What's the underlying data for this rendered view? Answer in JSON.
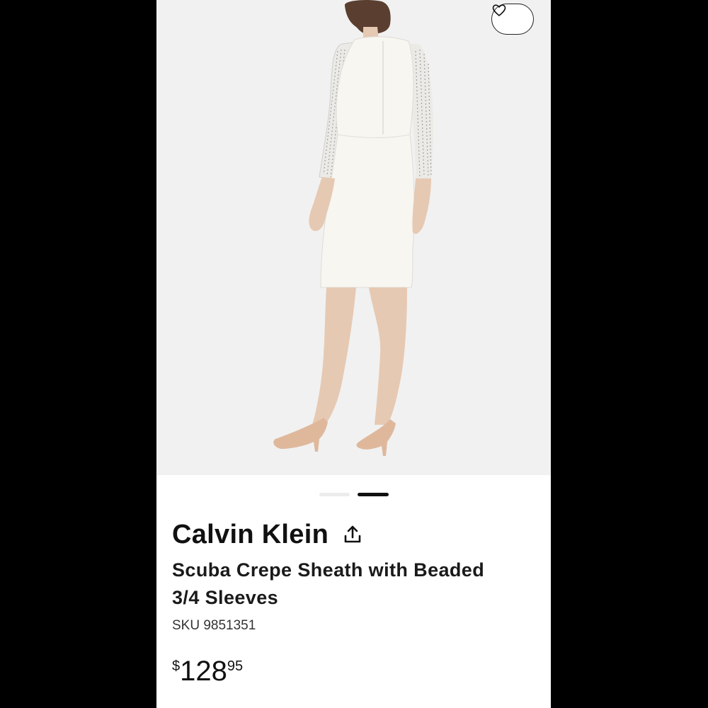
{
  "product": {
    "brand": "Calvin Klein",
    "title_line1": "Scuba Crepe Sheath with Beaded",
    "title_line2": "3/4 Sleeves",
    "sku": "SKU 9851351",
    "price": {
      "currency": "$",
      "dollars": "128",
      "cents": "95"
    }
  },
  "gallery": {
    "image_count": 2,
    "active_index": 2
  },
  "icons": {
    "favorite": "heart-outline-icon",
    "share": "share-upload-icon"
  },
  "colors": {
    "background": "#000000",
    "card": "#ffffff",
    "hero_bg": "#f1f1f1",
    "text": "#111111",
    "dress": "#f7f6f1",
    "heels": "#dfb89c"
  }
}
